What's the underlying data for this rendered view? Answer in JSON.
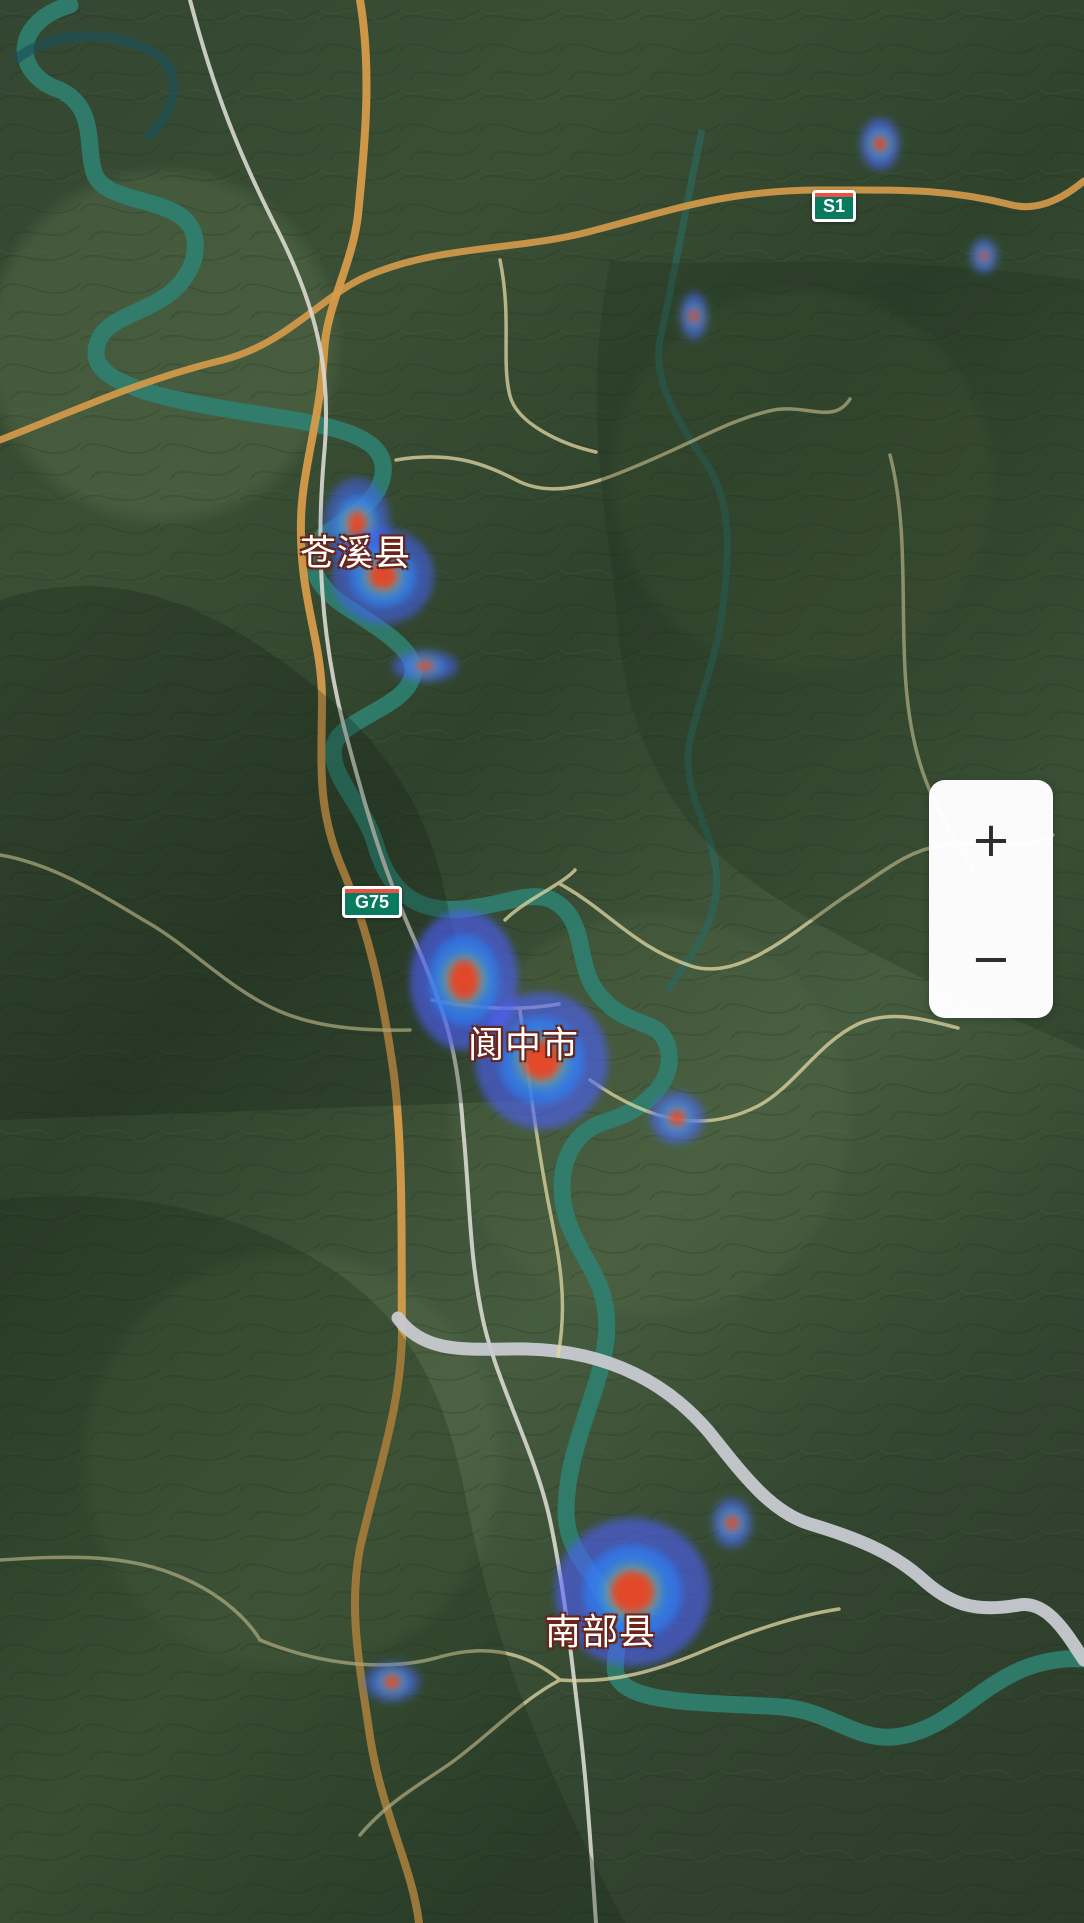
{
  "map": {
    "labels": {
      "cangxi": "苍溪县",
      "langzhong": "阆中市",
      "nanbu": "南部县"
    },
    "roads": {
      "s1": "S1",
      "g75": "G75"
    },
    "zoom": {
      "in": "+",
      "out": "−"
    },
    "colors": {
      "river": "#2f7f6f",
      "expressway": "#d69b4a",
      "rail": "#d9d8d0",
      "local_road": "#e2d7a3",
      "heat_low": "#4e5cff",
      "heat_mid": "#2fe7a9",
      "heat_high": "#ff2e16"
    }
  }
}
